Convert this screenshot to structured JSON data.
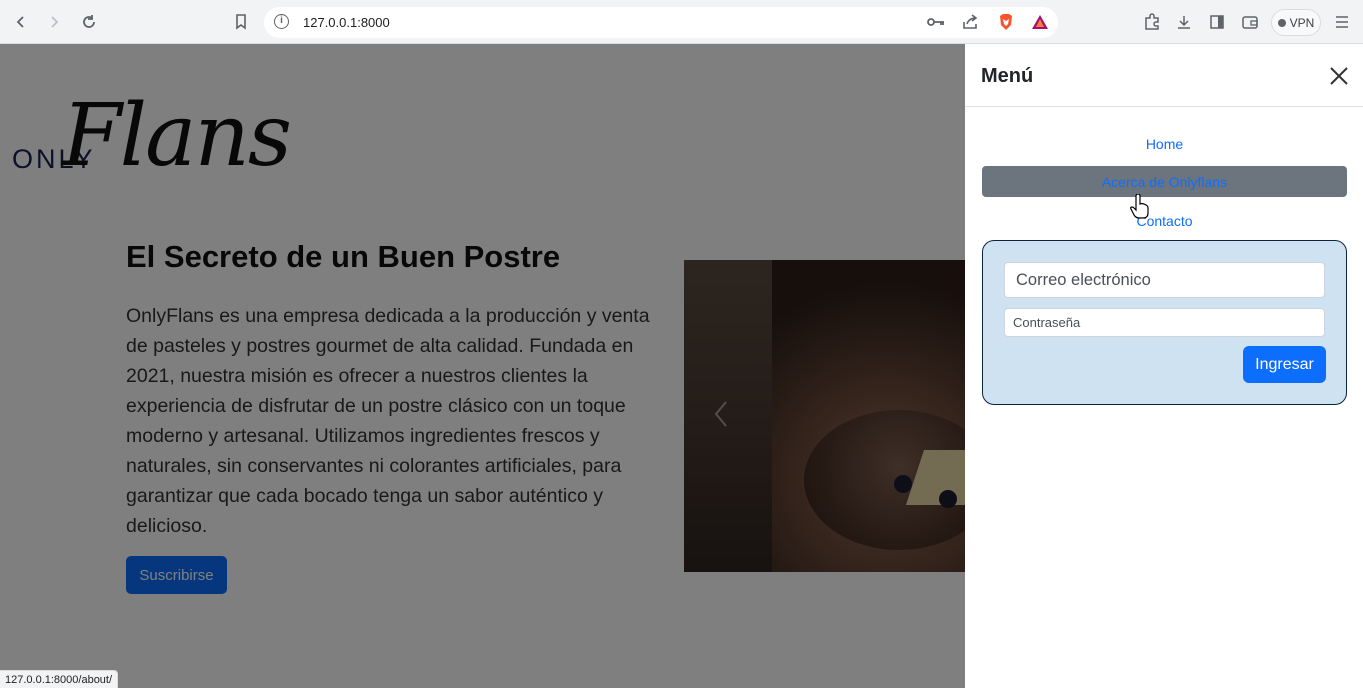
{
  "browser": {
    "url": "127.0.0.1:8000",
    "vpn_label": "VPN",
    "status_url": "127.0.0.1:8000/about/"
  },
  "page": {
    "logo_only": "ONLY",
    "logo_flans": "Flans",
    "hero_title": "El Secreto de un Buen Postre",
    "hero_text": "OnlyFlans es una empresa dedicada a la producción y venta de pasteles y postres gourmet de alta calidad. Fundada en 2021, nuestra misión es ofrecer a nuestros clientes la experiencia de disfrutar de un postre clásico con un toque moderno y artesanal. Utilizamos ingredientes frescos y naturales, sin conservantes ni colorantes artificiales, para garantizar que cada bocado tenga un sabor auténtico y delicioso.",
    "subscribe_label": "Suscribirse"
  },
  "menu": {
    "title": "Menú",
    "links": [
      {
        "label": "Home",
        "active": false
      },
      {
        "label": "Acerca de Onlyflans",
        "active": true
      },
      {
        "label": "Contacto",
        "active": false
      }
    ],
    "login": {
      "email_placeholder": "Correo electrónico",
      "password_placeholder": "Contraseña",
      "submit_label": "Ingresar"
    }
  },
  "colors": {
    "primary": "#0d6efd",
    "active_link_bg": "#6c757d",
    "login_panel_bg": "#cfe2f2"
  }
}
